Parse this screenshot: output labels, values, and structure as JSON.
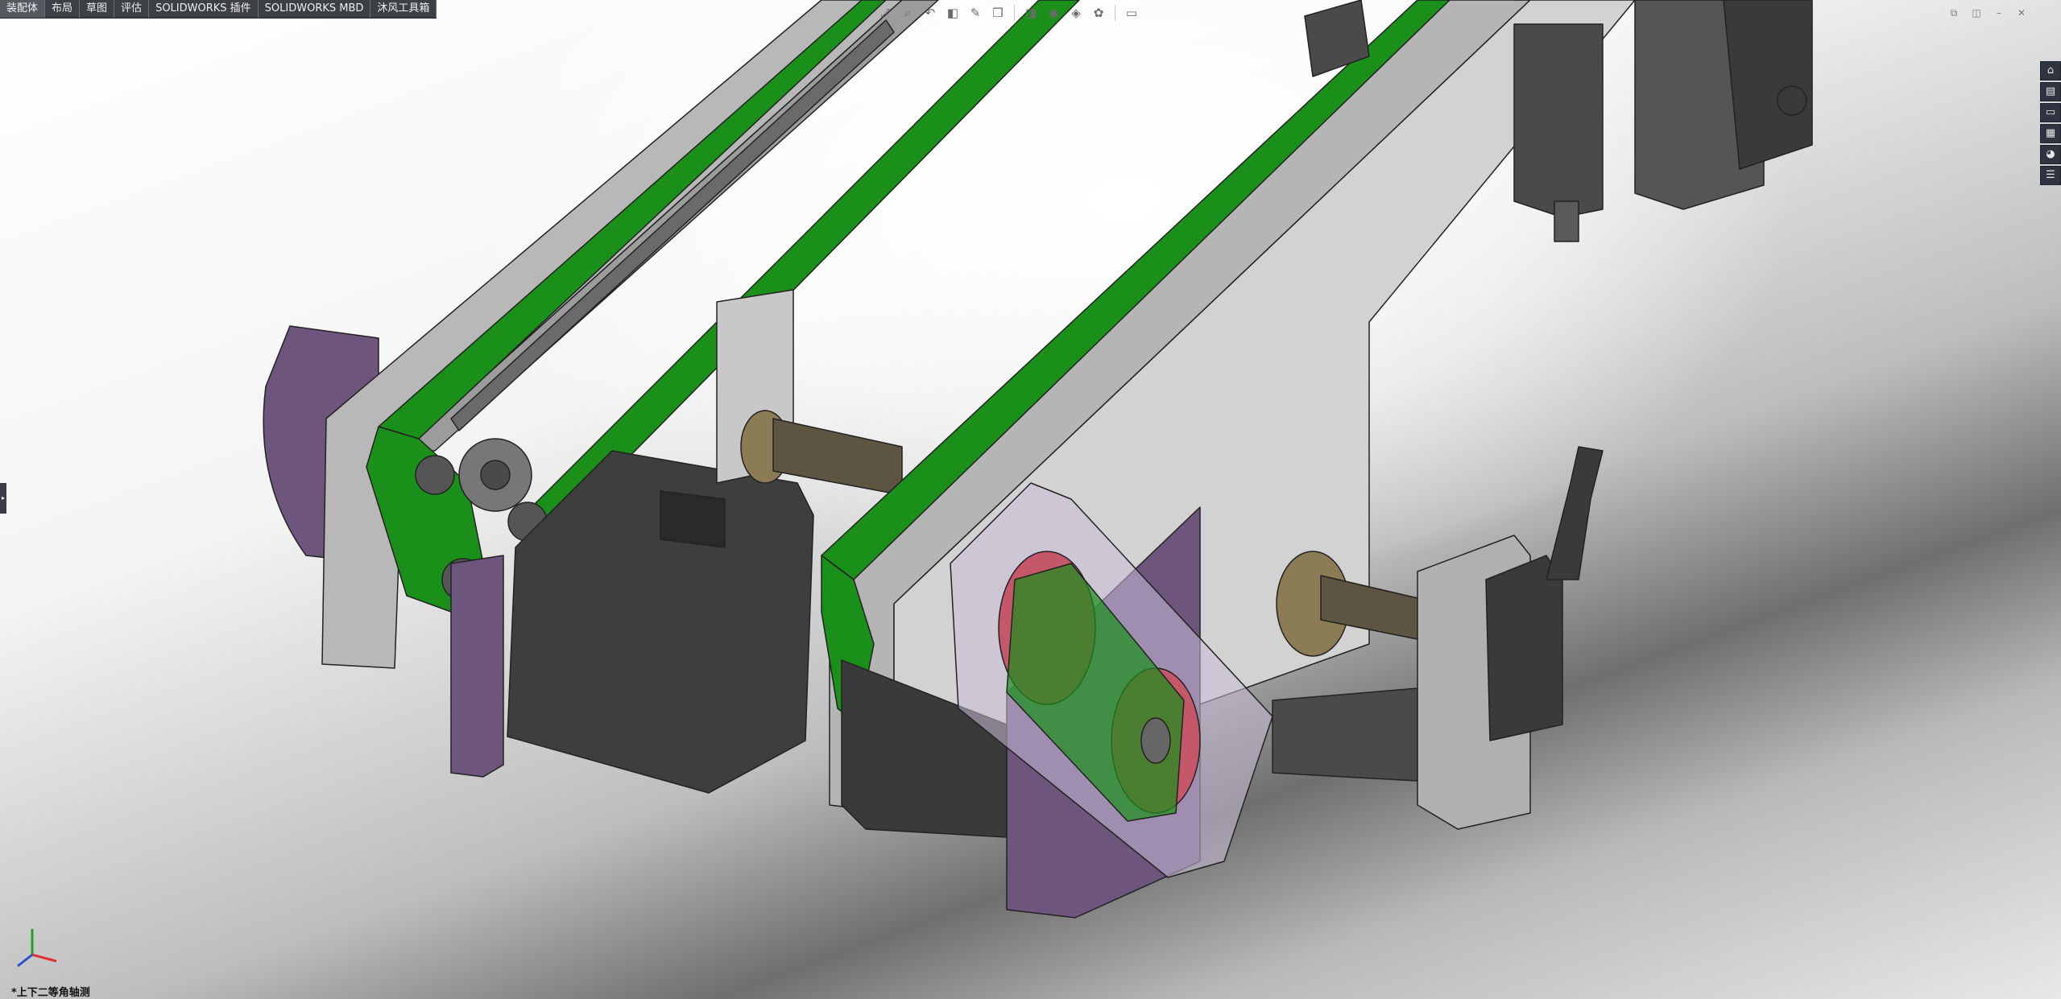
{
  "command_manager": {
    "tabs": [
      {
        "label": "装配体"
      },
      {
        "label": "布局"
      },
      {
        "label": "草图"
      },
      {
        "label": "评估"
      },
      {
        "label": "SOLIDWORKS 插件"
      },
      {
        "label": "SOLIDWORKS MBD"
      },
      {
        "label": "沐风工具箱"
      }
    ]
  },
  "view_toolbar": {
    "buttons": [
      {
        "icon": "zoom-to-fit-icon",
        "glyph": "⤢"
      },
      {
        "icon": "zoom-area-icon",
        "glyph": "⌕"
      },
      {
        "icon": "previous-view-icon",
        "glyph": "↶"
      },
      {
        "icon": "section-view-icon",
        "glyph": "◧"
      },
      {
        "icon": "dynamic-annotation-icon",
        "glyph": "✎"
      },
      {
        "icon": "view-orientation-icon",
        "glyph": "❒"
      },
      {
        "icon": "display-style-icon",
        "glyph": "◨"
      },
      {
        "icon": "hide-show-items-icon",
        "glyph": "◉"
      },
      {
        "icon": "edit-appearance-icon",
        "glyph": "◈"
      },
      {
        "icon": "apply-scene-icon",
        "glyph": "✿"
      },
      {
        "icon": "view-settings-icon",
        "glyph": "▭"
      }
    ]
  },
  "window_controls": [
    {
      "icon": "restore-icon",
      "glyph": "⧉"
    },
    {
      "icon": "tile-icon",
      "glyph": "◫"
    },
    {
      "icon": "minimize-icon",
      "glyph": "–"
    },
    {
      "icon": "close-icon",
      "glyph": "✕"
    }
  ],
  "task_pane": [
    {
      "icon": "home-icon",
      "glyph": "⌂"
    },
    {
      "icon": "design-library-icon",
      "glyph": "▤"
    },
    {
      "icon": "file-explorer-icon",
      "glyph": "▭"
    },
    {
      "icon": "view-palette-icon",
      "glyph": "▦"
    },
    {
      "icon": "appearances-icon",
      "glyph": "◕"
    },
    {
      "icon": "custom-properties-icon",
      "glyph": "☰"
    }
  ],
  "viewport": {
    "view_name": "*上下二等角轴测"
  },
  "colors": {
    "frame_gray": "#b5b5b5",
    "belt_green": "#1a8f1a",
    "motor_dark": "#3e3e3e",
    "bracket_purple": "#6e557e",
    "pulley_red": "#c4576a",
    "bronze": "#8c7c55",
    "tab_bar": "#3c3f44"
  }
}
